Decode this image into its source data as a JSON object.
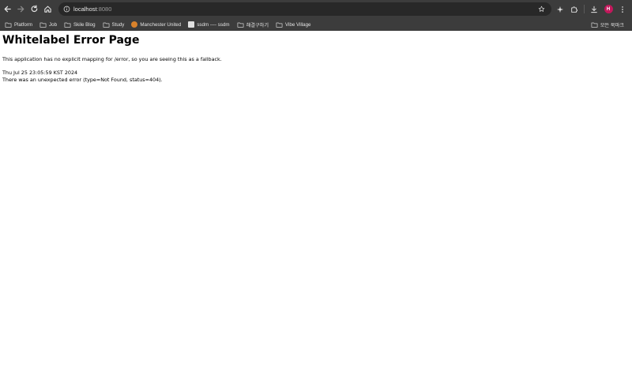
{
  "browser": {
    "url_host": "localhost",
    "url_port": ":8080",
    "profile_initial": "H",
    "avatar_color": "#c2185b"
  },
  "bookmarks": {
    "items": [
      {
        "label": "Platform",
        "icon": "folder-icon"
      },
      {
        "label": "Job",
        "icon": "folder-icon"
      },
      {
        "label": "Skile Blog",
        "icon": "folder-icon"
      },
      {
        "label": "Study",
        "icon": "folder-icon"
      },
      {
        "label": "Manchester United",
        "icon": "manchester-united-favicon"
      },
      {
        "label": "ssdm ---- ssdm",
        "icon": "ssdm-favicon"
      },
      {
        "label": "해결구하기",
        "icon": "folder-icon"
      },
      {
        "label": "Vibe Village",
        "icon": "folder-icon"
      }
    ],
    "all_bookmarks_label": "모든 북마크"
  },
  "page": {
    "title": "Whitelabel Error Page",
    "description": "This application has no explicit mapping for /error, so you are seeing this as a fallback.",
    "timestamp": "Thu Jul 25 23:05:59 KST 2024",
    "error": "There was an unexpected error (type=Not Found, status=404)."
  }
}
